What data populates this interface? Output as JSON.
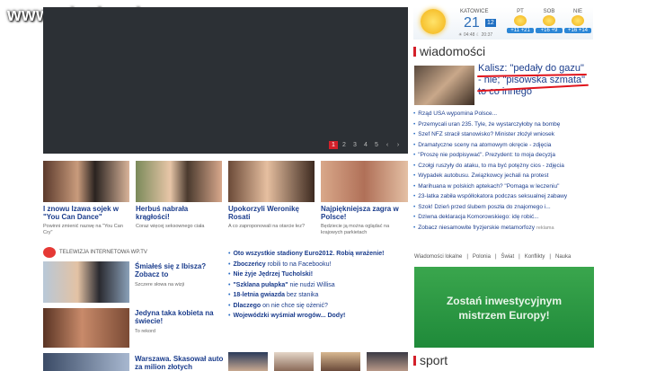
{
  "watermark": "www.wiocha.pl",
  "video": {
    "pages": [
      "1",
      "2",
      "3",
      "4",
      "5",
      "‹",
      "›"
    ],
    "active_page": "1"
  },
  "weather": {
    "city": "KATOWICE",
    "temp": "21",
    "badge": "12",
    "times": "☀ 04:48  ☾ 20:37",
    "days": [
      {
        "label": "PT",
        "temp": "+11 +21"
      },
      {
        "label": "SOB",
        "temp": "+16 +9"
      },
      {
        "label": "NIE",
        "temp": "+16 +14"
      }
    ]
  },
  "news": {
    "header": "wiadomości",
    "headline_line1": "Kalisz: \"pedały do gazu\"",
    "headline_line2": "- nie; \"pisowska szmata\"",
    "headline_line3": "to co innego",
    "items": [
      {
        "text": "Rząd USA wypomina Polsce...",
        "tag": ""
      },
      {
        "text": "Przemycali uran 235. Tyle, że wystarczyłoby na bombę",
        "tag": ""
      },
      {
        "text": "Szef NFZ stracił stanowisko? Minister złożył wniosek",
        "tag": ""
      },
      {
        "text": "Dramatyczne sceny na atomowym okręcie - zdjęcia",
        "tag": ""
      },
      {
        "text": "\"Proszę nie podpisywać\". Prezydent: to moja decyzja",
        "tag": ""
      },
      {
        "text": "Czołgi ruszyły do ataku, to ma być potężny cios - zdjęcia",
        "tag": ""
      },
      {
        "text": "Wypadek autobusu. Związkowcy jechali na protest",
        "tag": ""
      },
      {
        "text": "Marihuana w polskich aptekach? \"Pomaga w leczeniu\"",
        "tag": ""
      },
      {
        "text": "23-latka zabiła współlokatora podczas seksualnej zabawy",
        "tag": ""
      },
      {
        "text": "Szok! Dzień przed ślubem poszła do znajomego i...",
        "tag": ""
      },
      {
        "text": "Dziwna deklaracja Komorowskiego: idę robić...",
        "tag": ""
      },
      {
        "text": "Zobacz niesamowite fryzjerskie metamorfozy",
        "tag": "reklama"
      }
    ],
    "footer_links": [
      "Wiadomości lokalne",
      "Polonia",
      "Świat",
      "Konflikty",
      "Nauka"
    ]
  },
  "ad": {
    "line1": "Zostań inwestycyjnym",
    "line2": "mistrzem Europy!"
  },
  "sport_header": "sport",
  "tiles": [
    {
      "title": "I znowu Izawa sojek w \"You Can Dance\"",
      "sub": "Powinni zmienić nazwę na \"You Can Cry\""
    },
    {
      "title": "Herbuś nabrała krągłości!",
      "sub": "Coraz więcej seksownego ciała"
    },
    {
      "title": "Upokorzyli Weronikę Rosati",
      "sub": "A co zaproponowali na otarcie łez?"
    },
    {
      "title": "Najpiękniejsza zagra w Polsce!",
      "sub": "Będziecie ją można oglądać na krajowych parkietach"
    }
  ],
  "tv": {
    "header": "TELEWIZJA INTERNETOWA WP.TV",
    "items": [
      {
        "title": "Śmiałeś się z Ibisza? Zobacz to",
        "sub": "Szczere słowa na wizji"
      },
      {
        "title": "Jedyna taka kobieta na świecie!",
        "sub": "To rekord"
      },
      {
        "title": "Warszawa. Skasował auto za milion złotych",
        "sub": ""
      }
    ]
  },
  "mid_list": [
    {
      "bold": "Oto wszystkie stadiony Euro2012. Robią wrażenie!",
      "rest": ""
    },
    {
      "bold": "Zboczeńcy",
      "rest": " robili to na Facebooku!"
    },
    {
      "bold": "Nie żyje Jędrzej Tucholski!",
      "rest": ""
    },
    {
      "bold": "\"Szklana pułapka\"",
      "rest": " nie nudzi Willisa"
    },
    {
      "bold": "18-letnia gwiazda",
      "rest": " bez stanika"
    },
    {
      "bold": "Dlaczego",
      "rest": " on nie chce się ożenić?"
    },
    {
      "bold": "Wojewódzki wyśmiał wrogów... Dody!",
      "rest": ""
    }
  ]
}
